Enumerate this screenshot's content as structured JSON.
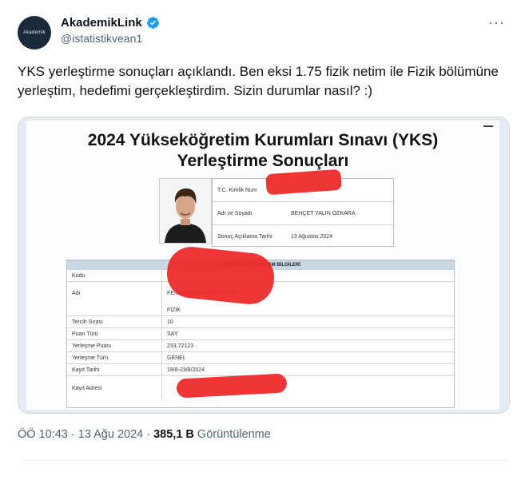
{
  "author": {
    "name": "AkademikLink",
    "handle": "@istatistikvean1",
    "avatar_text": "Akademik"
  },
  "more_label": "···",
  "tweet": {
    "text": "YKS yerleştirme sonuçları açıklandı. Ben eksi 1.75 fizik netim ile Fizik bölümüne yerleştim, hedefimi gerçekleştirdim. Sizin durumlar nasıl? :)"
  },
  "document": {
    "title_line1": "2024 Yükseköğretim Kurumları Sınavı (YKS)",
    "title_line2": "Yerleştirme Sonuçları",
    "info": [
      {
        "key": "T.C. Kimlik Num",
        "value": ""
      },
      {
        "key": "Adı ve Soyadı",
        "value": "BEHÇET YALIN ÖZKARA"
      },
      {
        "key": "Sonuç Açıklama Tarihi",
        "value": "13 Ağustos 2024"
      }
    ],
    "program_header": "YERLEŞTİĞİ PROGRAM BİLGİLERİ",
    "program_rows": [
      {
        "key": "Kodu",
        "value": ""
      },
      {
        "key": "Adı",
        "value": "FEN EDEBİYAT FAKÜLTESİ"
      },
      {
        "key": "",
        "value": "FİZİK"
      },
      {
        "key": "Tercih Sırası",
        "value": "10"
      },
      {
        "key": "Puan Türü",
        "value": "SAY"
      },
      {
        "key": "Yerleşme Puanı",
        "value": "233,72123"
      },
      {
        "key": "Yerleşme Türü",
        "value": "GENEL"
      },
      {
        "key": "Kayıt Tarihi",
        "value": "19/8-23/8/2024"
      },
      {
        "key": "Kayıt Adresi",
        "value": ""
      }
    ]
  },
  "footer": {
    "time": "ÖÖ 10:43 · 13 Ağu 2024 · ",
    "views": "385,1 B",
    "views_label": " Görüntülenme"
  },
  "colors": {
    "verified": "#1d9bf0",
    "redaction": "#ee2a2a",
    "secondary_text": "#536471"
  }
}
